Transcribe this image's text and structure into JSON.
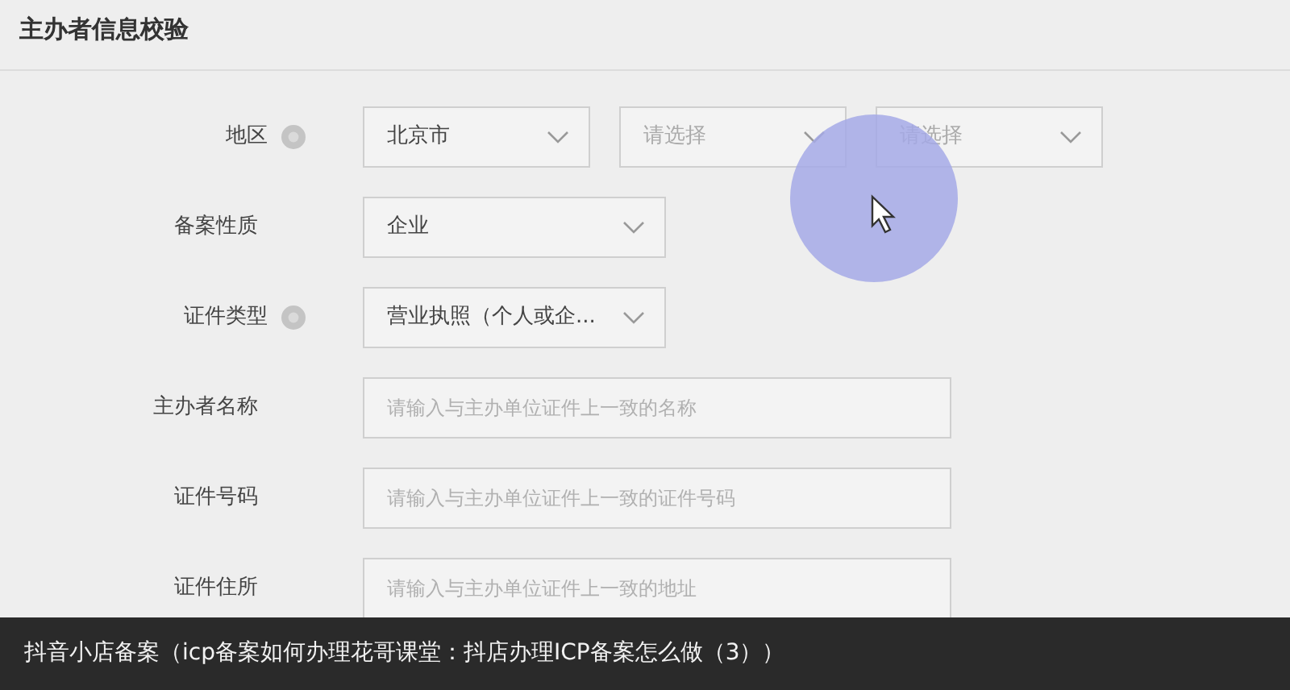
{
  "section_title": "主办者信息校验",
  "fields": [
    {
      "label": "地区",
      "info": true,
      "kind": "select",
      "controls": [
        {
          "value": "北京市"
        },
        {
          "placeholder": "请选择"
        },
        {
          "placeholder": "请选择"
        }
      ]
    },
    {
      "label": "备案性质",
      "info": false,
      "kind": "select",
      "controls": [
        {
          "value": "企业"
        }
      ]
    },
    {
      "label": "证件类型",
      "info": true,
      "kind": "select",
      "controls": [
        {
          "value": "营业执照（个人或企..."
        }
      ]
    },
    {
      "label": "主办者名称",
      "info": false,
      "kind": "input",
      "controls": [
        {
          "placeholder": "请输入与主办单位证件上一致的名称"
        }
      ]
    },
    {
      "label": "证件号码",
      "info": false,
      "kind": "input",
      "controls": [
        {
          "placeholder": "请输入与主办单位证件上一致的证件号码"
        }
      ]
    },
    {
      "label": "证件住所",
      "info": false,
      "kind": "input",
      "controls": [
        {
          "placeholder": "请输入与主办单位证件上一致的地址"
        }
      ]
    }
  ],
  "caption": "抖音小店备案（icp备案如何办理花哥课堂：抖店办理ICP备案怎么做（3））"
}
